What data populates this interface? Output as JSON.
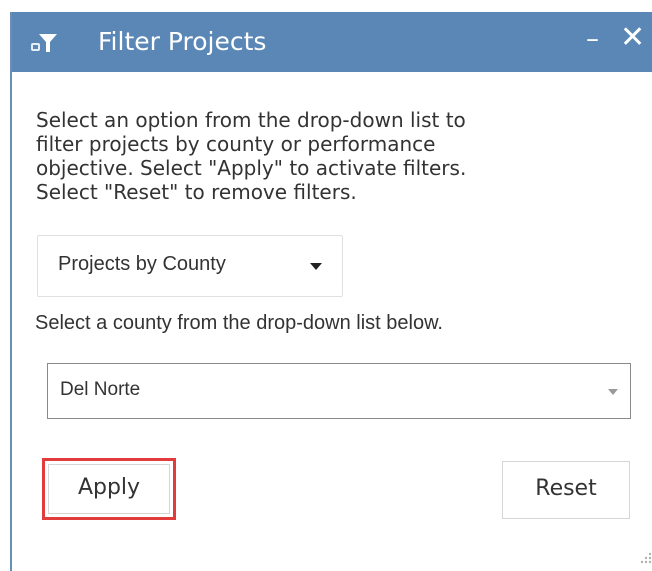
{
  "window": {
    "title": "Filter Projects",
    "icon": "filter-icon",
    "minimize_label": "–",
    "close_label": "✕"
  },
  "instructions": {
    "lines": [
      "Select an option from the drop-down list to",
      "filter projects by county or performance",
      "objective. Select \"Apply\" to activate filters.",
      "Select \"Reset\" to remove filters."
    ]
  },
  "filter_mode": {
    "selected": "Projects by County"
  },
  "county": {
    "prompt": "Select a county from the drop-down list below.",
    "selected": "Del Norte"
  },
  "buttons": {
    "apply_label": "Apply",
    "reset_label": "Reset"
  },
  "colors": {
    "titlebar": "#5b87b7",
    "highlight": "#e23b3b"
  }
}
